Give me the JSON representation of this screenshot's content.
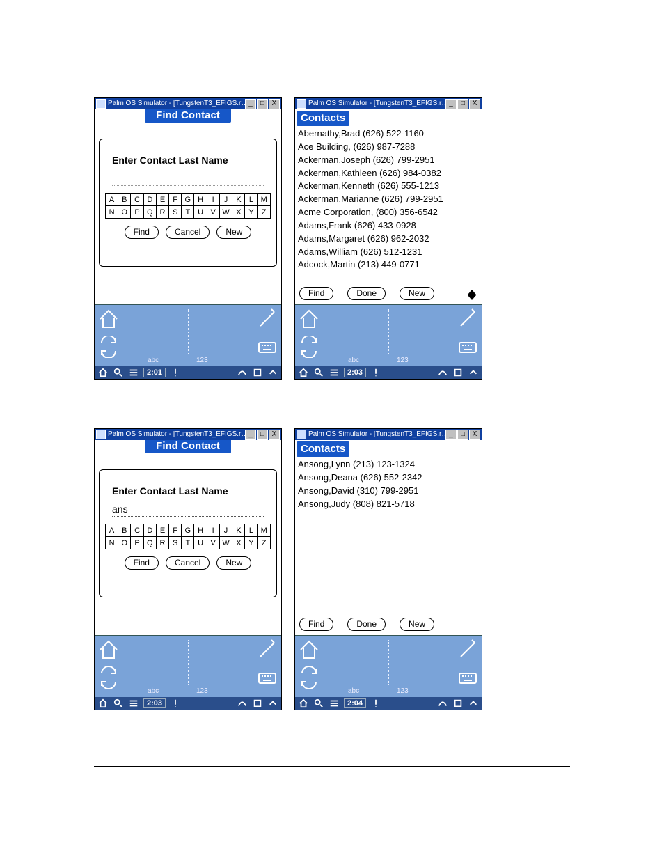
{
  "window_title": "Palm OS Simulator - [TungstenT3_EFIGS.r…",
  "winbtn_min": "_",
  "winbtn_max": "□",
  "winbtn_close": "X",
  "screens": {
    "a": {
      "modal_title": "Find Contact",
      "prompt": "Enter Contact Last Name",
      "input_value": "",
      "buttons": {
        "find": "Find",
        "cancel": "Cancel",
        "new": "New"
      },
      "time": "2:01"
    },
    "b": {
      "app_title": "Contacts",
      "list": [
        "Abernathy,Brad (626) 522-1160",
        "Ace Building,  (626) 987-7288",
        "Ackerman,Joseph (626) 799-2951",
        "Ackerman,Kathleen (626) 984-0382",
        "Ackerman,Kenneth (626) 555-1213",
        "Ackerman,Marianne (626) 799-2951",
        "Acme Corporation, (800) 356-6542",
        "Adams,Frank (626) 433-0928",
        "Adams,Margaret (626) 962-2032",
        "Adams,William (626) 512-1231",
        "Adcock,Martin (213) 449-0771"
      ],
      "buttons": {
        "find": "Find",
        "done": "Done",
        "new": "New"
      },
      "time": "2:03"
    },
    "c": {
      "modal_title": "Find Contact",
      "prompt": "Enter Contact Last Name",
      "input_value": "ans",
      "buttons": {
        "find": "Find",
        "cancel": "Cancel",
        "new": "New"
      },
      "time": "2:03"
    },
    "d": {
      "app_title": "Contacts",
      "list": [
        "Ansong,Lynn (213) 123-1324",
        "Ansong,Deana (626) 552-2342",
        "Ansong,David (310) 799-2951",
        "Ansong,Judy (808) 821-5718"
      ],
      "buttons": {
        "find": "Find",
        "done": "Done",
        "new": "New"
      },
      "time": "2:04"
    }
  },
  "alpha_row1": [
    "A",
    "B",
    "C",
    "D",
    "E",
    "F",
    "G",
    "H",
    "I",
    "J",
    "K",
    "L",
    "M"
  ],
  "alpha_row2": [
    "N",
    "O",
    "P",
    "Q",
    "R",
    "S",
    "T",
    "U",
    "V",
    "W",
    "X",
    "Y",
    "Z"
  ],
  "silk_lbl_abc": "abc",
  "silk_lbl_123": "123"
}
